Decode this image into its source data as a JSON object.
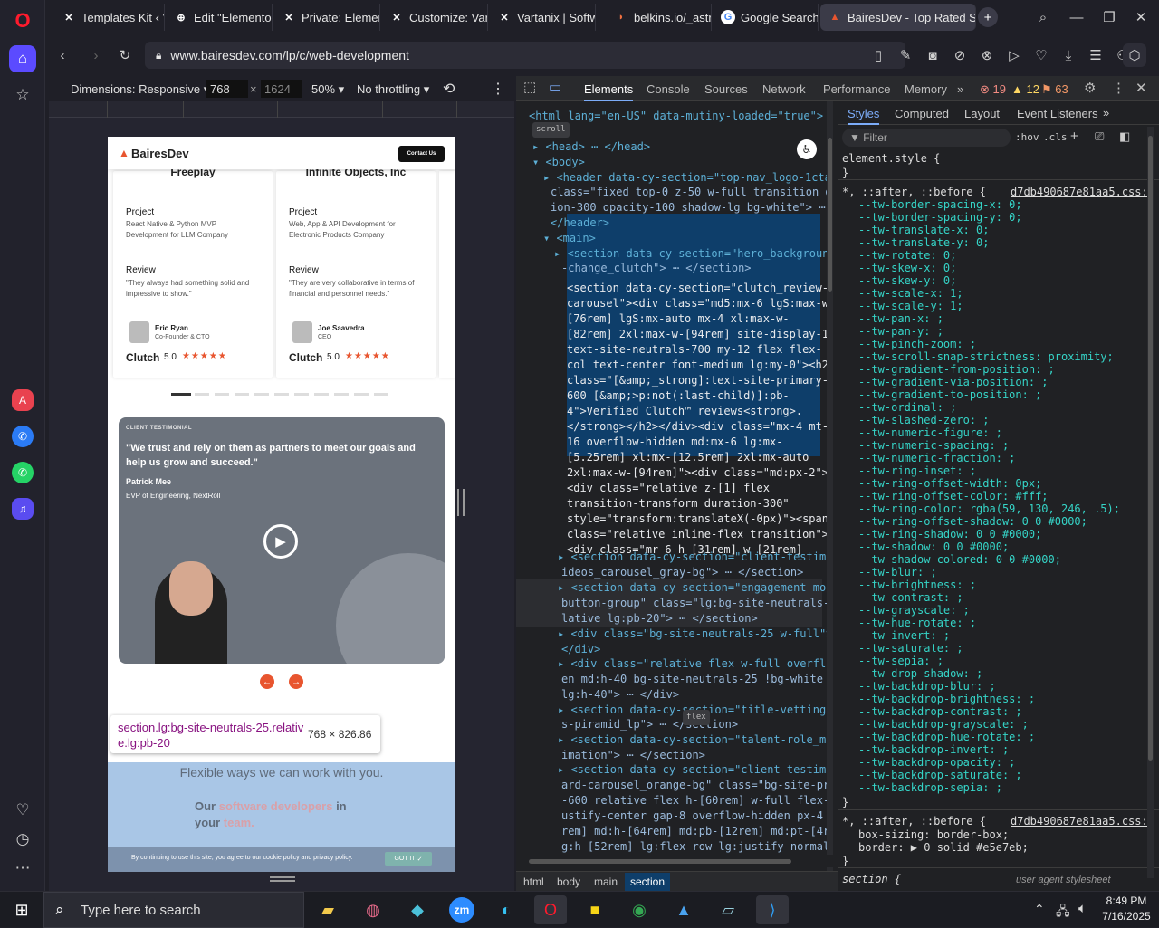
{
  "browser": {
    "tabs": [
      {
        "title": "Templates Kit ‹ V",
        "icon": "wordpress-icon"
      },
      {
        "title": "Edit \"Elementor F",
        "icon": "wordpress-icon"
      },
      {
        "title": "Private: Elemento",
        "icon": "wordpress-icon"
      },
      {
        "title": "Customize: Varta",
        "icon": "wordpress-icon"
      },
      {
        "title": "Vartanix | Softwa",
        "icon": "wordpress-icon"
      },
      {
        "title": "belkins.io/_astro,",
        "icon": "site-icon"
      },
      {
        "title": "Google Search",
        "icon": "google-icon"
      },
      {
        "title": "BairesDev - Top Rated Sof",
        "icon": "bairesdev-icon"
      }
    ],
    "url": "www.bairesdev.com/lp/c/web-development"
  },
  "device_toolbar": {
    "dimensions_label": "Dimensions: Responsive",
    "width": "768",
    "height": "1624",
    "zoom": "50%",
    "throttling": "No throttling"
  },
  "page": {
    "logo": "BairesDev",
    "contact_button": "Contact Us",
    "cards": [
      {
        "company": "Freeplay",
        "project_label": "Project",
        "project": "React Native & Python MVP Development for LLM Company",
        "review_label": "Review",
        "review": "\"They always had something solid and impressive to show.\"",
        "person": "Eric Ryan",
        "role": "Co-Founder & CTO",
        "clutch": "Clutch",
        "score": "5.0"
      },
      {
        "company": "Infinite Objects, Inc",
        "project_label": "Project",
        "project": "Web, App & API Development for Electronic Products Company",
        "review_label": "Review",
        "review": "\"They are very collaborative in terms of financial and personnel needs.\"",
        "person": "Joe Saavedra",
        "role": "CEO",
        "clutch": "Clutch",
        "score": "5.0"
      }
    ],
    "testimonial": {
      "kicker": "CLIENT TESTIMONIAL",
      "quote": "\"We trust and rely on them as partners to meet our goals and help us grow and succeed.\"",
      "name": "Patrick Mee",
      "title": "EVP of Engineering, NextRoll"
    },
    "tooltip_selector": "section.lg:bg-site-neutrals-25.relative.lg:pb-20",
    "tooltip_size": "768 × 826.86",
    "flexible_heading": "Flexible ways we can work with you.",
    "our_text_1": "Our ",
    "our_text_2": "software developers",
    "our_text_3": " in",
    "our_text_4": "your ",
    "our_text_5": "team.",
    "cookie_text": "By continuing to use this site, you agree to our cookie policy and privacy policy.",
    "cookie_button": "GOT IT"
  },
  "devtools": {
    "tabs": [
      "Elements",
      "Console",
      "Sources",
      "Network",
      "Performance",
      "Memory"
    ],
    "errors": "19",
    "warnings": "12",
    "issues": "63",
    "style_tabs": [
      "Styles",
      "Computed",
      "Layout",
      "Event Listeners"
    ],
    "filter_placeholder": "Filter",
    "hov": ":hov",
    "cls": ".cls",
    "breadcrumbs": [
      "html",
      "body",
      "main",
      "section"
    ],
    "element_style": "element.style {",
    "rule1_selector": "*, ::after, ::before {",
    "rule1_source": "d7db490687e81aa5.css:3",
    "rule2_selector": "*, ::after, ::before {",
    "rule2_source": "d7db490687e81aa5.css:3",
    "section_rule": "section {",
    "ua_stylesheet": "user agent stylesheet",
    "css_props": [
      "--tw-border-spacing-x: 0;",
      "--tw-border-spacing-y: 0;",
      "--tw-translate-x: 0;",
      "--tw-translate-y: 0;",
      "--tw-rotate: 0;",
      "--tw-skew-x: 0;",
      "--tw-skew-y: 0;",
      "--tw-scale-x: 1;",
      "--tw-scale-y: 1;",
      "--tw-pan-x: ;",
      "--tw-pan-y: ;",
      "--tw-pinch-zoom: ;",
      "--tw-scroll-snap-strictness: proximity;",
      "--tw-gradient-from-position: ;",
      "--tw-gradient-via-position: ;",
      "--tw-gradient-to-position: ;",
      "--tw-ordinal: ;",
      "--tw-slashed-zero: ;",
      "--tw-numeric-figure: ;",
      "--tw-numeric-spacing: ;",
      "--tw-numeric-fraction: ;",
      "--tw-ring-inset: ;",
      "--tw-ring-offset-width: 0px;",
      "--tw-ring-offset-color: #fff;",
      "--tw-ring-color: rgba(59, 130, 246, .5);",
      "--tw-ring-offset-shadow: 0 0 #0000;",
      "--tw-ring-shadow: 0 0 #0000;",
      "--tw-shadow: 0 0 #0000;",
      "--tw-shadow-colored: 0 0 #0000;",
      "--tw-blur: ;",
      "--tw-brightness: ;",
      "--tw-contrast: ;",
      "--tw-grayscale: ;",
      "--tw-hue-rotate: ;",
      "--tw-invert: ;",
      "--tw-saturate: ;",
      "--tw-sepia: ;",
      "--tw-drop-shadow: ;",
      "--tw-backdrop-blur: ;",
      "--tw-backdrop-brightness: ;",
      "--tw-backdrop-contrast: ;",
      "--tw-backdrop-grayscale: ;",
      "--tw-backdrop-hue-rotate: ;",
      "--tw-backdrop-invert: ;",
      "--tw-backdrop-opacity: ;",
      "--tw-backdrop-saturate: ;",
      "--tw-backdrop-sepia: ;"
    ],
    "rule2_props": [
      "box-sizing: border-box;",
      "border: ▶ 0 solid #e5e7eb;"
    ],
    "dom_lines": [
      "<html lang=\"en-US\" data-mutiny-loaded=\"true\">",
      "▸ <head> ⋯ </head>",
      "▾ <body>",
      "▸ <header data-cy-section=\"top-nav_logo-1cta\"",
      "class=\"fixed top-0 z-50 w-full transition dura",
      "ion-300 opacity-100 shadow-lg bg-white\"> ⋯",
      "</header>",
      "▾ <main>",
      "▸ <section data-cy-section=\"hero_background-cl",
      "-change_clutch\"> ⋯ </section>",
      "<section data-cy-section=\"clutch_review-",
      "carousel\"><div class=\"md5:mx-6 lgS:max-w-",
      "[76rem] lgS:mx-auto mx-4 xl:max-w-",
      "[82rem] 2xl:max-w-[94rem] site-display-1",
      "text-site-neutrals-700 my-12 flex flex-",
      "col text-center font-medium lg:my-0\"><h2",
      "class=\"[&amp;_strong]:text-site-primary-",
      "600 [&amp;>p:not(:last-child)]:pb-",
      "4\">Verified Clutch™ reviews<strong>.",
      "</strong></h2></div><div class=\"mx-4 mt-",
      "16 overflow-hidden md:mx-6 lg:mx-",
      "[5.25rem] xl:mx-[12.5rem] 2xl:mx-auto",
      "2xl:max-w-[94rem]\"><div class=\"md:px-2\">",
      "<div class=\"relative z-[1] flex",
      "transition-transform duration-300\"",
      "style=\"transform:translateX(-0px)\"><span",
      "class=\"relative inline-flex transition\">",
      "<div class=\"mr-6 h-[31rem] w-[21rem]",
      "▸ <section data-cy-section=\"client-testimonia",
      "ideos_carousel_gray-bg\"> ⋯ </section>",
      "▸ <section data-cy-section=\"engagement-models_",
      "button-group\" class=\"lg:bg-site-neutrals-25",
      "lative lg:pb-20\"> ⋯ </section>",
      "▸ <div class=\"bg-site-neutrals-25 w-full\"> ⋯",
      "</div>",
      "▸ <div class=\"relative flex w-full overflow-hi",
      "en md:h-40 bg-site-neutrals-25 !bg-white h-",
      "lg:h-40\"> ⋯ </div>",
      "▸ <section data-cy-section=\"title-vetting-proc",
      "s-piramid_lp\"> ⋯ </section>",
      "▸ <section data-cy-section=\"talent-role_merge-",
      "imation\"> ⋯ </section>",
      "▸ <section data-cy-section=\"client-testimonia",
      "ard-carousel_orange-bg\" class=\"bg-site-prima",
      "-600 relative flex h-[60rem] w-full flex-col",
      "ustify-center gap-8 overflow-hidden px-4 py-",
      "rem] md:h-[64rem] md:pb-[12rem] md:pt-[4rem]",
      "g:h-[52rem] lg:flex-row lg:justify-normal lg"
    ]
  },
  "taskbar": {
    "search_placeholder": "Type here to search",
    "time": "8:49 PM",
    "date": "7/16/2025"
  }
}
